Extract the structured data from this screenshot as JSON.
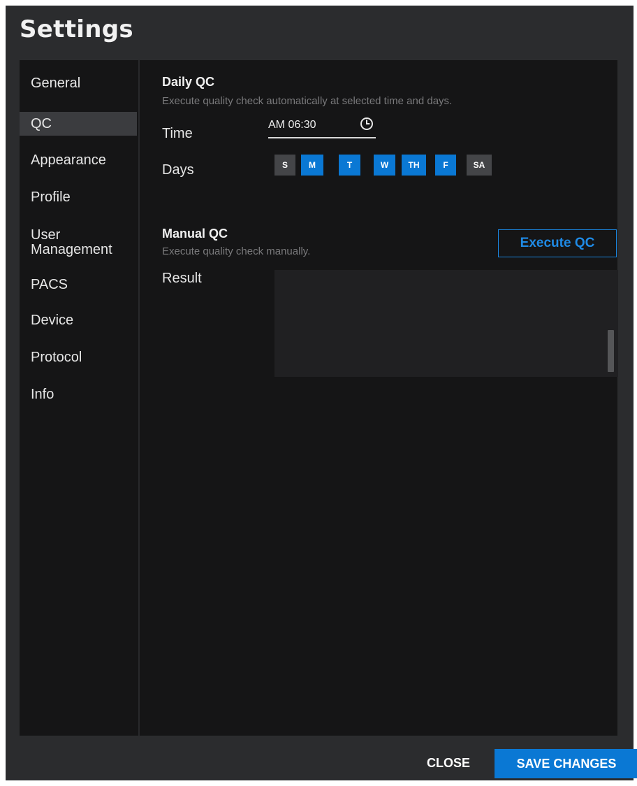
{
  "window": {
    "title": "Settings"
  },
  "sidebar": {
    "items": [
      {
        "label": "General"
      },
      {
        "label": "QC",
        "active": true
      },
      {
        "label": "Appearance"
      },
      {
        "label": "Profile"
      },
      {
        "label": "User Management",
        "line1": "User",
        "line2": "Management"
      },
      {
        "label": "PACS"
      },
      {
        "label": "Device"
      },
      {
        "label": "Protocol"
      },
      {
        "label": "Info"
      }
    ]
  },
  "daily_qc": {
    "title": "Daily QC",
    "description": "Execute quality check automatically at selected time and days.",
    "time_label": "Time",
    "time_value": "AM 06:30",
    "time_icon": "clock-icon",
    "days_label": "Days",
    "days": [
      {
        "label": "S",
        "selected": false
      },
      {
        "label": "M",
        "selected": true
      },
      {
        "label": "T",
        "selected": true
      },
      {
        "label": "W",
        "selected": true
      },
      {
        "label": "TH",
        "selected": true
      },
      {
        "label": "F",
        "selected": true
      },
      {
        "label": "SA",
        "selected": false
      }
    ]
  },
  "manual_qc": {
    "title": "Manual QC",
    "description": "Execute quality check manually.",
    "execute_label": "Execute QC",
    "result_label": "Result"
  },
  "footer": {
    "close_label": "CLOSE",
    "save_label": "SAVE CHANGES"
  },
  "colors": {
    "accent": "#0a78d4",
    "dialog_bg": "#2b2c2e",
    "panel_bg": "#151516",
    "day_off": "#444548"
  }
}
